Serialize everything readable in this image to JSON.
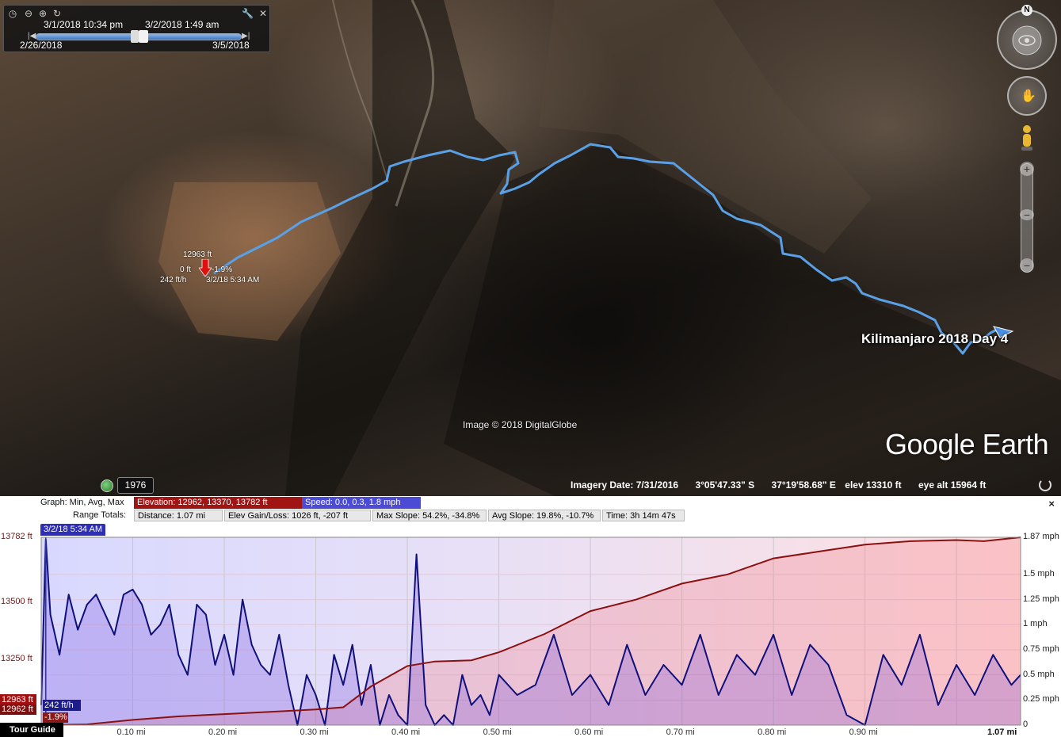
{
  "time_slider": {
    "start_label": "3/1/2018  10:34 pm",
    "end_label": "3/2/2018   1:49 am",
    "range_start": "2/26/2018",
    "range_end": "3/5/2018"
  },
  "map": {
    "track_title": "Kilimanjaro 2018   Day 4",
    "copyright": "Image © 2018 DigitalGlobe",
    "logo": "Google Earth",
    "marker": {
      "elevation": "12963 ft",
      "distance": "0 ft",
      "slope": "-1.9%",
      "speed": "242 ft/h",
      "time": "3/2/18 5:34 AM"
    },
    "historical_year": "1976",
    "compass_label": "N"
  },
  "status_bar": {
    "imagery_date": "Imagery Date: 7/31/2016",
    "lat": "3°05'47.33\" S",
    "lon": "37°19'58.68\" E",
    "elev": "elev 13310 ft",
    "eye_alt": "eye alt 15964 ft"
  },
  "profile": {
    "graph_label": "Graph: Min, Avg, Max",
    "elevation_stats": "Elevation: 12962, 13370, 13782 ft",
    "speed_stats": "Speed: 0.0, 0.3, 1.8 mph",
    "range_label": "Range Totals:",
    "distance": "Distance: 1.07 mi",
    "elev_gain_loss": "Elev Gain/Loss: 1026 ft, -207 ft",
    "max_slope": "Max Slope: 54.2%, -34.8%",
    "avg_slope": "Avg Slope: 19.8%, -10.7%",
    "time": "Time: 3h 14m 47s",
    "cursor_time": "3/2/18 5:34 AM",
    "close_icon": "×",
    "cursor_elev": "12963 ft",
    "cursor_elev_min": "12962 ft",
    "cursor_speed": "242 ft/h",
    "cursor_slope": "-1.9%",
    "tour_guide": "Tour Guide"
  },
  "chart_data": {
    "type": "line",
    "x_axis": {
      "label_units": "mi",
      "ticks": [
        "0.10 mi",
        "0.20 mi",
        "0.30 mi",
        "0.40 mi",
        "0.50 mi",
        "0.60 mi",
        "0.70 mi",
        "0.80 mi",
        "0.90 mi",
        "1.07 mi"
      ],
      "range": [
        0,
        1.07
      ]
    },
    "y_left": {
      "ticks": [
        "13782 ft",
        "13500 ft",
        "13250 ft"
      ],
      "range": [
        12962,
        13782
      ]
    },
    "y_right": {
      "ticks": [
        "1.87 mph",
        "1.5 mph",
        "1.25 mph",
        "1 mph",
        "0.75 mph",
        "0.5 mph",
        "0.25 mph",
        "0"
      ],
      "range": [
        0,
        1.87
      ]
    },
    "series": [
      {
        "name": "Elevation",
        "color": "#8b1010",
        "x": [
          0,
          0.05,
          0.1,
          0.15,
          0.2,
          0.25,
          0.3,
          0.33,
          0.36,
          0.4,
          0.43,
          0.47,
          0.5,
          0.55,
          0.58,
          0.6,
          0.65,
          0.7,
          0.75,
          0.8,
          0.85,
          0.9,
          0.95,
          1.0,
          1.03,
          1.07
        ],
        "y": [
          12962,
          12965,
          12985,
          13000,
          13010,
          13020,
          13030,
          13040,
          13130,
          13220,
          13240,
          13245,
          13280,
          13360,
          13420,
          13460,
          13510,
          13580,
          13620,
          13690,
          13720,
          13750,
          13765,
          13770,
          13765,
          13782
        ]
      },
      {
        "name": "Speed",
        "color": "#10107a",
        "x": [
          0,
          0.005,
          0.01,
          0.02,
          0.03,
          0.04,
          0.05,
          0.06,
          0.07,
          0.08,
          0.09,
          0.1,
          0.11,
          0.12,
          0.13,
          0.14,
          0.15,
          0.16,
          0.17,
          0.18,
          0.19,
          0.2,
          0.21,
          0.22,
          0.23,
          0.24,
          0.25,
          0.26,
          0.27,
          0.28,
          0.29,
          0.3,
          0.31,
          0.32,
          0.33,
          0.34,
          0.35,
          0.36,
          0.37,
          0.38,
          0.39,
          0.4,
          0.41,
          0.42,
          0.43,
          0.44,
          0.45,
          0.46,
          0.47,
          0.48,
          0.49,
          0.5,
          0.52,
          0.54,
          0.56,
          0.58,
          0.6,
          0.62,
          0.64,
          0.66,
          0.68,
          0.7,
          0.72,
          0.74,
          0.76,
          0.78,
          0.8,
          0.82,
          0.84,
          0.86,
          0.88,
          0.9,
          0.92,
          0.94,
          0.96,
          0.98,
          1.0,
          1.02,
          1.04,
          1.06,
          1.07
        ],
        "y": [
          0.2,
          1.85,
          1.1,
          0.7,
          1.3,
          0.95,
          1.2,
          1.3,
          1.1,
          0.9,
          1.3,
          1.35,
          1.2,
          0.9,
          1.0,
          1.2,
          0.7,
          0.5,
          1.2,
          1.1,
          0.6,
          0.9,
          0.5,
          1.25,
          0.8,
          0.6,
          0.5,
          0.9,
          0.4,
          0.0,
          0.5,
          0.3,
          0.0,
          0.7,
          0.4,
          0.8,
          0.2,
          0.6,
          0.0,
          0.3,
          0.1,
          0.0,
          1.7,
          0.2,
          0.0,
          0.1,
          0.0,
          0.5,
          0.2,
          0.3,
          0.1,
          0.5,
          0.3,
          0.4,
          0.9,
          0.3,
          0.5,
          0.2,
          0.8,
          0.3,
          0.6,
          0.4,
          0.9,
          0.3,
          0.7,
          0.5,
          0.9,
          0.3,
          0.8,
          0.6,
          0.1,
          0.0,
          0.7,
          0.4,
          0.9,
          0.2,
          0.6,
          0.3,
          0.7,
          0.4,
          0.5
        ]
      }
    ]
  }
}
